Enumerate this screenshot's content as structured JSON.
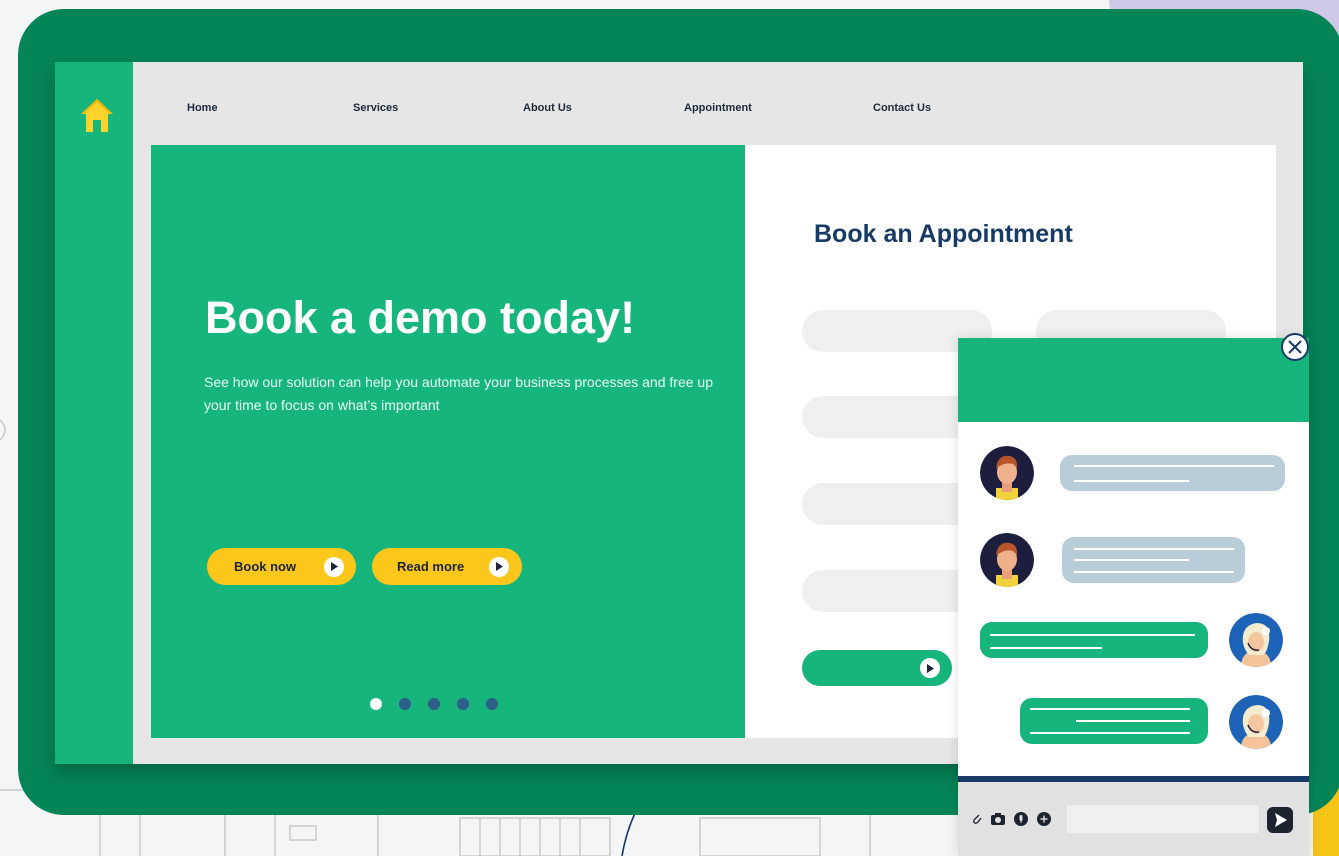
{
  "nav": {
    "items": [
      {
        "label": "Home"
      },
      {
        "label": "Services"
      },
      {
        "label": "About Us"
      },
      {
        "label": "Appointment"
      },
      {
        "label": "Contact Us"
      }
    ]
  },
  "hero": {
    "title": "Book a demo today!",
    "subtitle": "See how our solution can help you automate your business processes and free up your time to focus on what’s  important",
    "book_now_label": "Book now",
    "read_more_label": "Read more",
    "slides": {
      "count": 5,
      "active": 1
    }
  },
  "form": {
    "title": "Book an Appointment"
  },
  "chat": {
    "messages": [
      {
        "from": "customer"
      },
      {
        "from": "customer"
      },
      {
        "from": "agent"
      },
      {
        "from": "agent"
      }
    ]
  },
  "colors": {
    "monitor": "#048558",
    "accent_green": "#15b57c",
    "button_yellow": "#fcc61b",
    "navy": "#173b66",
    "incoming_bubble": "#b9cdd8"
  },
  "icons": {
    "home": "home-icon",
    "play": "play-icon",
    "close": "close-icon",
    "attach": "paperclip-icon",
    "camera": "camera-icon",
    "mic": "microphone-icon",
    "add": "plus-circle-icon",
    "send": "send-icon"
  }
}
